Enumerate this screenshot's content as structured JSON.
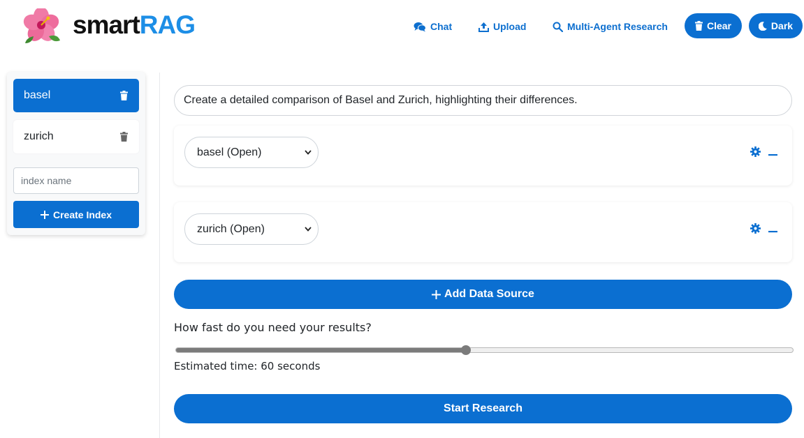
{
  "header": {
    "brand_part1": "smart",
    "brand_part2": "RAG",
    "logo_icon": "hibiscus-icon",
    "nav": [
      {
        "label": "Chat",
        "icon": "chat-icon"
      },
      {
        "label": "Upload",
        "icon": "upload-icon"
      },
      {
        "label": "Multi-Agent Research",
        "icon": "search-icon"
      }
    ],
    "clear_label": "Clear",
    "dark_label": "Dark"
  },
  "sidebar": {
    "indexes": [
      {
        "name": "basel",
        "active": true
      },
      {
        "name": "zurich",
        "active": false
      }
    ],
    "index_name_placeholder": "index name",
    "create_label": "Create Index"
  },
  "main": {
    "query": "Create a detailed comparison of Basel and Zurich, highlighting their differences.",
    "sources": [
      {
        "selected": "basel (Open)"
      },
      {
        "selected": "zurich (Open)"
      }
    ],
    "add_source_label": "Add Data Source",
    "speed_question": "How fast do you need your results?",
    "slider_fraction": 0.47,
    "estimated_time": "Estimated time: 60 seconds",
    "start_label": "Start Research"
  },
  "colors": {
    "primary": "#0b6fd1",
    "brand_blue": "#1d8ee6",
    "nav_text": "#0d6fcf"
  }
}
